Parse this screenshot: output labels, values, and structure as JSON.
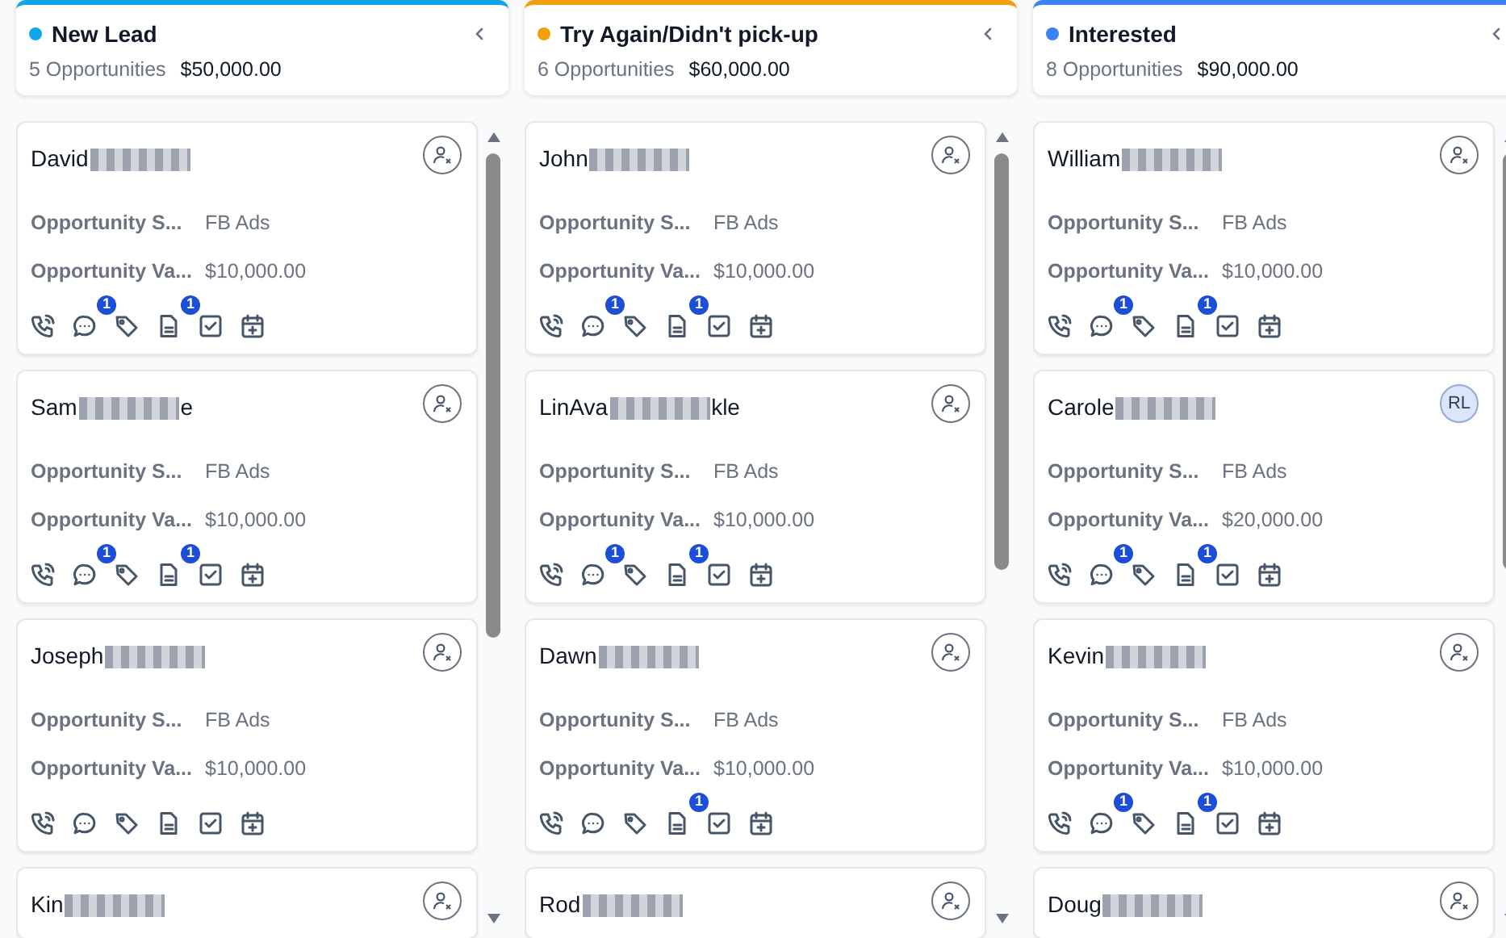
{
  "columns": [
    {
      "title": "New Lead",
      "color": "#0ea5e9",
      "count": "5 Opportunities",
      "total": "$50,000.00",
      "cards": [
        {
          "name": "David",
          "assignee": {
            "kind": "unassigned"
          },
          "fields": [
            {
              "label": "Opportunity S...",
              "value": "FB Ads"
            },
            {
              "label": "Opportunity Va...",
              "value": "$10,000.00"
            }
          ],
          "actions": [
            {
              "kind": "call"
            },
            {
              "kind": "message",
              "badge": "1"
            },
            {
              "kind": "tag"
            },
            {
              "kind": "note",
              "badge": "1"
            },
            {
              "kind": "task"
            },
            {
              "kind": "appointment"
            }
          ]
        },
        {
          "name": "Sam",
          "name_end": "e",
          "assignee": {
            "kind": "unassigned"
          },
          "fields": [
            {
              "label": "Opportunity S...",
              "value": "FB Ads"
            },
            {
              "label": "Opportunity Va...",
              "value": "$10,000.00"
            }
          ],
          "actions": [
            {
              "kind": "call"
            },
            {
              "kind": "message",
              "badge": "1"
            },
            {
              "kind": "tag"
            },
            {
              "kind": "note",
              "badge": "1"
            },
            {
              "kind": "task"
            },
            {
              "kind": "appointment"
            }
          ]
        },
        {
          "name": "Joseph",
          "assignee": {
            "kind": "unassigned"
          },
          "fields": [
            {
              "label": "Opportunity S...",
              "value": "FB Ads"
            },
            {
              "label": "Opportunity Va...",
              "value": "$10,000.00"
            }
          ],
          "actions": [
            {
              "kind": "call"
            },
            {
              "kind": "message"
            },
            {
              "kind": "tag"
            },
            {
              "kind": "note"
            },
            {
              "kind": "task"
            },
            {
              "kind": "appointment"
            }
          ]
        },
        {
          "name": "Kin",
          "assignee": {
            "kind": "unassigned"
          }
        }
      ]
    },
    {
      "title": "Try Again/Didn't pick-up",
      "color": "#f59e0b",
      "count": "6 Opportunities",
      "total": "$60,000.00",
      "cards": [
        {
          "name": "John",
          "assignee": {
            "kind": "unassigned"
          },
          "fields": [
            {
              "label": "Opportunity S...",
              "value": "FB Ads"
            },
            {
              "label": "Opportunity Va...",
              "value": "$10,000.00"
            }
          ],
          "actions": [
            {
              "kind": "call"
            },
            {
              "kind": "message",
              "badge": "1"
            },
            {
              "kind": "tag"
            },
            {
              "kind": "note",
              "badge": "1"
            },
            {
              "kind": "task"
            },
            {
              "kind": "appointment"
            }
          ]
        },
        {
          "name": "LinAva",
          "name_end": "kle",
          "assignee": {
            "kind": "unassigned"
          },
          "fields": [
            {
              "label": "Opportunity S...",
              "value": "FB Ads"
            },
            {
              "label": "Opportunity Va...",
              "value": "$10,000.00"
            }
          ],
          "actions": [
            {
              "kind": "call"
            },
            {
              "kind": "message",
              "badge": "1"
            },
            {
              "kind": "tag"
            },
            {
              "kind": "note",
              "badge": "1"
            },
            {
              "kind": "task"
            },
            {
              "kind": "appointment"
            }
          ]
        },
        {
          "name": "Dawn",
          "assignee": {
            "kind": "unassigned"
          },
          "fields": [
            {
              "label": "Opportunity S...",
              "value": "FB Ads"
            },
            {
              "label": "Opportunity Va...",
              "value": "$10,000.00"
            }
          ],
          "actions": [
            {
              "kind": "call"
            },
            {
              "kind": "message"
            },
            {
              "kind": "tag"
            },
            {
              "kind": "note",
              "badge": "1"
            },
            {
              "kind": "task"
            },
            {
              "kind": "appointment"
            }
          ]
        },
        {
          "name": "Rod",
          "assignee": {
            "kind": "unassigned"
          }
        }
      ]
    },
    {
      "title": "Interested",
      "color": "#3b82f6",
      "count": "8 Opportunities",
      "total": "$90,000.00",
      "cards": [
        {
          "name": "William",
          "assignee": {
            "kind": "unassigned"
          },
          "fields": [
            {
              "label": "Opportunity S...",
              "value": "FB Ads"
            },
            {
              "label": "Opportunity Va...",
              "value": "$10,000.00"
            }
          ],
          "actions": [
            {
              "kind": "call"
            },
            {
              "kind": "message",
              "badge": "1"
            },
            {
              "kind": "tag"
            },
            {
              "kind": "note",
              "badge": "1"
            },
            {
              "kind": "task"
            },
            {
              "kind": "appointment"
            }
          ]
        },
        {
          "name": "Carole",
          "assignee": {
            "kind": "avatar",
            "initials": "RL"
          },
          "fields": [
            {
              "label": "Opportunity S...",
              "value": "FB Ads"
            },
            {
              "label": "Opportunity Va...",
              "value": "$20,000.00"
            }
          ],
          "actions": [
            {
              "kind": "call"
            },
            {
              "kind": "message",
              "badge": "1"
            },
            {
              "kind": "tag"
            },
            {
              "kind": "note",
              "badge": "1"
            },
            {
              "kind": "task"
            },
            {
              "kind": "appointment"
            }
          ]
        },
        {
          "name": "Kevin",
          "assignee": {
            "kind": "unassigned"
          },
          "fields": [
            {
              "label": "Opportunity S...",
              "value": "FB Ads"
            },
            {
              "label": "Opportunity Va...",
              "value": "$10,000.00"
            }
          ],
          "actions": [
            {
              "kind": "call"
            },
            {
              "kind": "message",
              "badge": "1"
            },
            {
              "kind": "tag"
            },
            {
              "kind": "note",
              "badge": "1"
            },
            {
              "kind": "task"
            },
            {
              "kind": "appointment"
            }
          ]
        },
        {
          "name": "Doug",
          "assignee": {
            "kind": "unassigned"
          }
        }
      ]
    }
  ]
}
